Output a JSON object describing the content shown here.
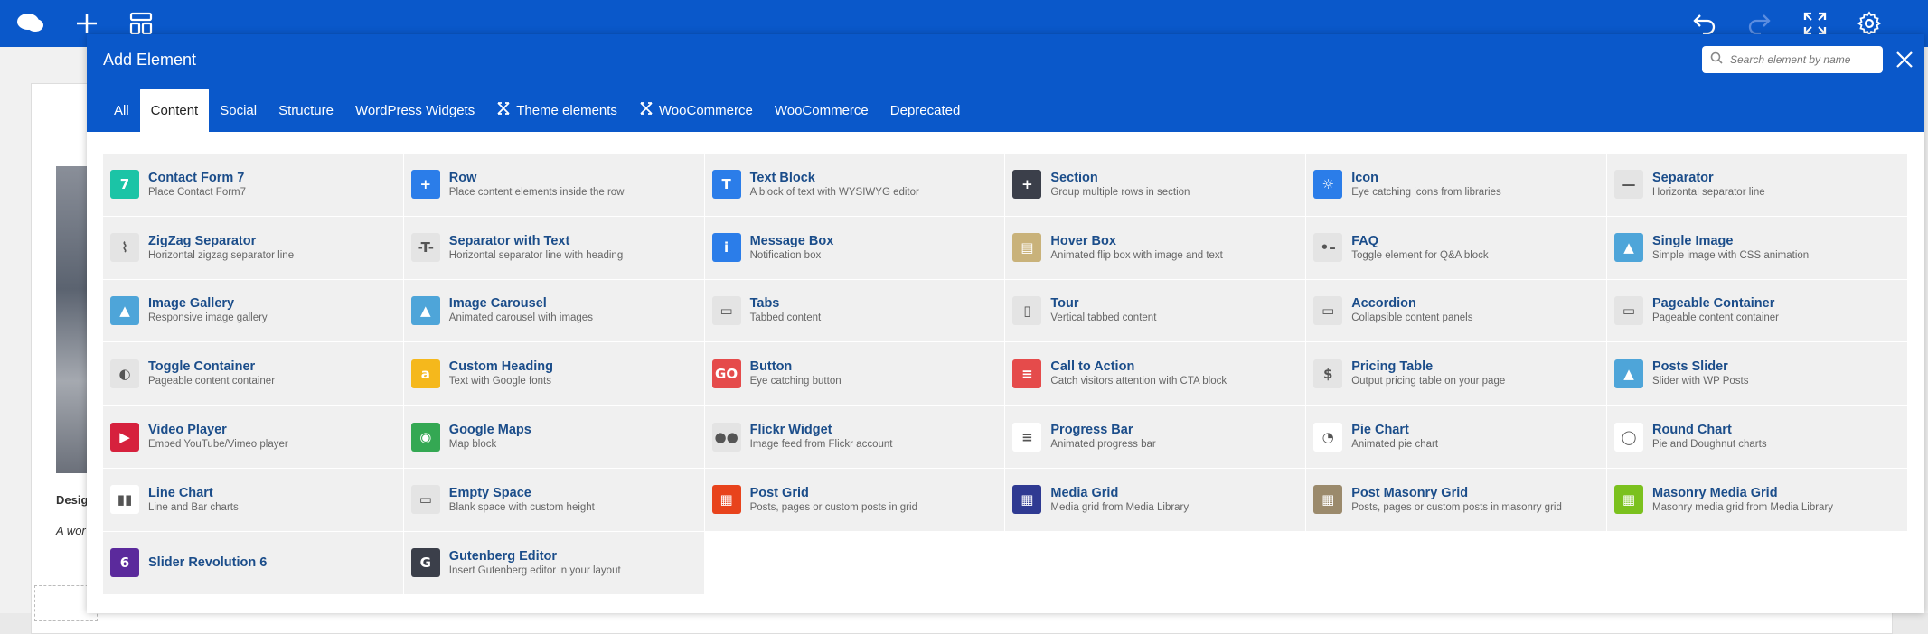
{
  "modal": {
    "title": "Add Element",
    "search_placeholder": "Search element by name"
  },
  "page": {
    "text1": "Desig",
    "text2": "A wor"
  },
  "tabs": [
    {
      "label": "All"
    },
    {
      "label": "Content"
    },
    {
      "label": "Social"
    },
    {
      "label": "Structure"
    },
    {
      "label": "WordPress Widgets"
    },
    {
      "label": "Theme elements"
    },
    {
      "label": "WooCommerce"
    },
    {
      "label": "WooCommerce"
    },
    {
      "label": "Deprecated"
    }
  ],
  "elements": [
    {
      "name": "Contact Form 7",
      "desc": "Place Contact Form7",
      "icon": "contact-form-icon",
      "color": "#1bc4a6",
      "glyph": "7"
    },
    {
      "name": "Row",
      "desc": "Place content elements inside the row",
      "icon": "row-plus-icon",
      "color": "#2b7de9",
      "glyph": "+"
    },
    {
      "name": "Text Block",
      "desc": "A block of text with WYSIWYG editor",
      "icon": "text-block-icon",
      "color": "#2b7de9",
      "glyph": "T"
    },
    {
      "name": "Section",
      "desc": "Group multiple rows in section",
      "icon": "section-plus-icon",
      "color": "#3b3f4a",
      "glyph": "+"
    },
    {
      "name": "Icon",
      "desc": "Eye catching icons from libraries",
      "icon": "sun-icon",
      "color": "#2b7de9",
      "glyph": "☼"
    },
    {
      "name": "Separator",
      "desc": "Horizontal separator line",
      "icon": "separator-icon",
      "color": "#e4e4e4",
      "glyph": "—"
    },
    {
      "name": "ZigZag Separator",
      "desc": "Horizontal zigzag separator line",
      "icon": "zigzag-icon",
      "color": "#e4e4e4",
      "glyph": "⌇"
    },
    {
      "name": "Separator with Text",
      "desc": "Horizontal separator line with heading",
      "icon": "separator-text-icon",
      "color": "#e4e4e4",
      "glyph": "-T-"
    },
    {
      "name": "Message Box",
      "desc": "Notification box",
      "icon": "info-icon",
      "color": "#2b7de9",
      "glyph": "i"
    },
    {
      "name": "Hover Box",
      "desc": "Animated flip box with image and text",
      "icon": "hover-box-icon",
      "color": "#c9b27a",
      "glyph": "▤"
    },
    {
      "name": "FAQ",
      "desc": "Toggle element for Q&A block",
      "icon": "faq-icon",
      "color": "#e4e4e4",
      "glyph": "•–"
    },
    {
      "name": "Single Image",
      "desc": "Simple image with CSS animation",
      "icon": "image-icon",
      "color": "#4ea5d9",
      "glyph": "▲"
    },
    {
      "name": "Image Gallery",
      "desc": "Responsive image gallery",
      "icon": "gallery-icon",
      "color": "#4ea5d9",
      "glyph": "▲"
    },
    {
      "name": "Image Carousel",
      "desc": "Animated carousel with images",
      "icon": "carousel-icon",
      "color": "#4ea5d9",
      "glyph": "▲"
    },
    {
      "name": "Tabs",
      "desc": "Tabbed content",
      "icon": "tabs-icon",
      "color": "#e4e4e4",
      "glyph": "▭"
    },
    {
      "name": "Tour",
      "desc": "Vertical tabbed content",
      "icon": "tour-icon",
      "color": "#e4e4e4",
      "glyph": "▯"
    },
    {
      "name": "Accordion",
      "desc": "Collapsible content panels",
      "icon": "accordion-icon",
      "color": "#e4e4e4",
      "glyph": "▭"
    },
    {
      "name": "Pageable Container",
      "desc": "Pageable content container",
      "icon": "pageable-icon",
      "color": "#e4e4e4",
      "glyph": "▭"
    },
    {
      "name": "Toggle Container",
      "desc": "Pageable content container",
      "icon": "toggle-icon",
      "color": "#e4e4e4",
      "glyph": "◐"
    },
    {
      "name": "Custom Heading",
      "desc": "Text with Google fonts",
      "icon": "heading-icon",
      "color": "#f5b81c",
      "glyph": "a"
    },
    {
      "name": "Button",
      "desc": "Eye catching button",
      "icon": "go-button-icon",
      "color": "#e54b4b",
      "glyph": "GO"
    },
    {
      "name": "Call to Action",
      "desc": "Catch visitors attention with CTA block",
      "icon": "cta-icon",
      "color": "#e54b4b",
      "glyph": "≡"
    },
    {
      "name": "Pricing Table",
      "desc": "Output pricing table on your page",
      "icon": "pricing-icon",
      "color": "#e4e4e4",
      "glyph": "$"
    },
    {
      "name": "Posts Slider",
      "desc": "Slider with WP Posts",
      "icon": "posts-slider-icon",
      "color": "#4ea5d9",
      "glyph": "▲"
    },
    {
      "name": "Video Player",
      "desc": "Embed YouTube/Vimeo player",
      "icon": "play-icon",
      "color": "#d6213d",
      "glyph": "▶"
    },
    {
      "name": "Google Maps",
      "desc": "Map block",
      "icon": "map-pin-icon",
      "color": "#34a853",
      "glyph": "◉"
    },
    {
      "name": "Flickr Widget",
      "desc": "Image feed from Flickr account",
      "icon": "flickr-icon",
      "color": "#e4e4e4",
      "glyph": "●●"
    },
    {
      "name": "Progress Bar",
      "desc": "Animated progress bar",
      "icon": "progress-icon",
      "color": "#ffffff",
      "glyph": "≡"
    },
    {
      "name": "Pie Chart",
      "desc": "Animated pie chart",
      "icon": "pie-chart-icon",
      "color": "#ffffff",
      "glyph": "◔"
    },
    {
      "name": "Round Chart",
      "desc": "Pie and Doughnut charts",
      "icon": "round-chart-icon",
      "color": "#ffffff",
      "glyph": "◯"
    },
    {
      "name": "Line Chart",
      "desc": "Line and Bar charts",
      "icon": "bar-chart-icon",
      "color": "#ffffff",
      "glyph": "▮▮"
    },
    {
      "name": "Empty Space",
      "desc": "Blank space with custom height",
      "icon": "empty-space-icon",
      "color": "#e4e4e4",
      "glyph": "▭"
    },
    {
      "name": "Post Grid",
      "desc": "Posts, pages or custom posts in grid",
      "icon": "post-grid-icon",
      "color": "#e8431c",
      "glyph": "▦"
    },
    {
      "name": "Media Grid",
      "desc": "Media grid from Media Library",
      "icon": "media-grid-icon",
      "color": "#2f3a92",
      "glyph": "▦"
    },
    {
      "name": "Post Masonry Grid",
      "desc": "Posts, pages or custom posts in masonry grid",
      "icon": "masonry-grid-icon",
      "color": "#9b8a6c",
      "glyph": "▦"
    },
    {
      "name": "Masonry Media Grid",
      "desc": "Masonry media grid from Media Library",
      "icon": "masonry-media-icon",
      "color": "#7bc11e",
      "glyph": "▦"
    },
    {
      "name": "Slider Revolution 6",
      "desc": "",
      "icon": "slider-revolution-icon",
      "color": "#5b2a9c",
      "glyph": "6"
    },
    {
      "name": "Gutenberg Editor",
      "desc": "Insert Gutenberg editor in your layout",
      "icon": "gutenberg-icon",
      "color": "#3b3f4a",
      "glyph": "G"
    }
  ]
}
